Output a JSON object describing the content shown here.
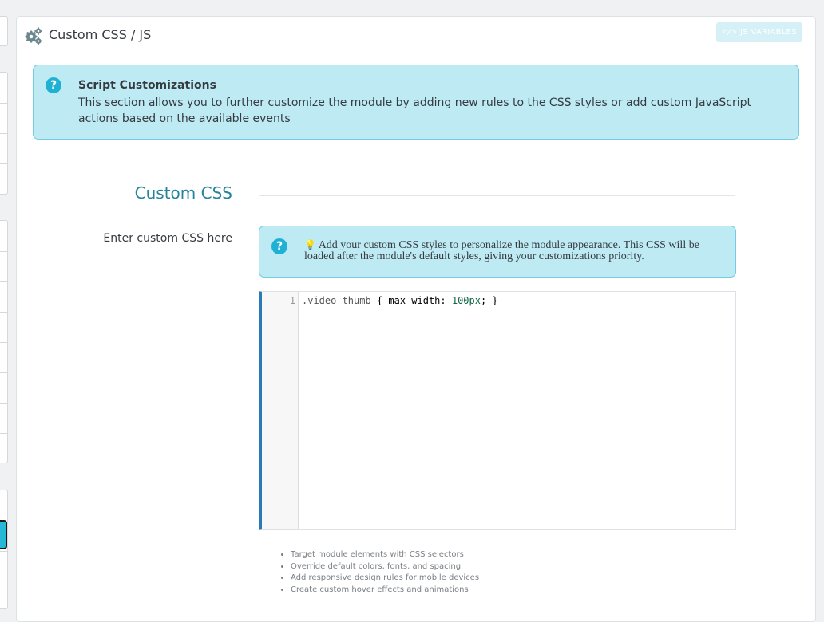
{
  "panel": {
    "title": "Custom CSS / JS",
    "js_variables_button": "JS VARIABLES",
    "js_variables_icon": "code-icon"
  },
  "alert": {
    "icon": "question-circle-icon",
    "heading": "Script Customizations",
    "text": "This section allows you to further customize the module by adding new rules to the CSS styles or add custom JavaScript actions based on the available events"
  },
  "section": {
    "title": "Custom CSS"
  },
  "field": {
    "label": "Enter custom CSS here",
    "help_icon": "question-circle-icon",
    "help_text": "Add your custom CSS styles to personalize the module appearance. This CSS will be loaded after the module's default styles, giving your customizations priority."
  },
  "editor": {
    "line_numbers": [
      "1"
    ],
    "code": {
      "selector": ".video-thumb",
      "open": " { max-width: ",
      "number": "100px",
      "close": "; }"
    }
  },
  "tips": [
    "Target module elements with CSS selectors",
    "Override default colors, fonts, and spacing",
    "Add responsive design rules for mobile devices",
    "Create custom hover effects and animations"
  ],
  "colors": {
    "accent": "#25b9d7",
    "info_bg": "#bdeaf3",
    "editor_border": "#2a7ab5",
    "section_title": "#25839a"
  }
}
